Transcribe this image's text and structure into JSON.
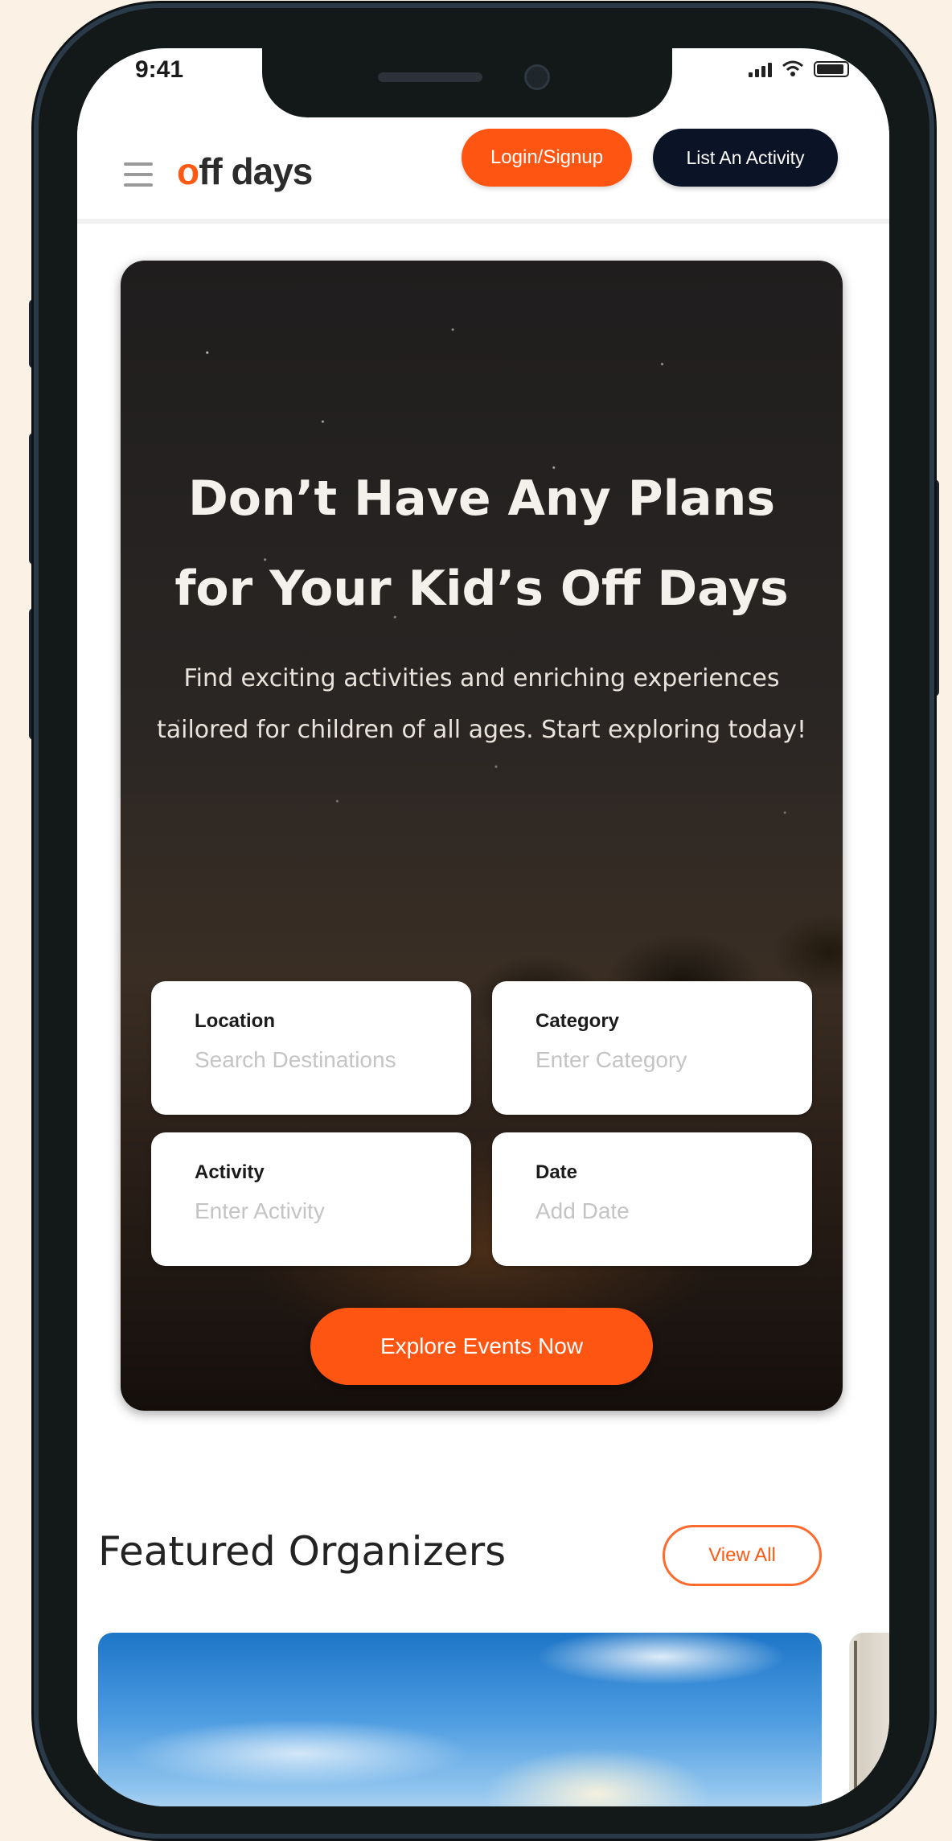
{
  "status_bar": {
    "time": "9:41"
  },
  "header": {
    "logo_first": "o",
    "logo_rest": "ff days",
    "login_label": "Login/Signup",
    "list_activity_label": "List An Activity"
  },
  "hero": {
    "title_line1": "Don’t Have Any Plans",
    "title_line2": "for Your Kid’s Off Days",
    "subtitle": "Find exciting activities and enriching experiences tailored for children of all ages. Start exploring today!",
    "fields": [
      {
        "label": "Location",
        "placeholder": "Search Destinations"
      },
      {
        "label": "Category",
        "placeholder": "Enter Category"
      },
      {
        "label": "Activity",
        "placeholder": "Enter Activity"
      },
      {
        "label": "Date",
        "placeholder": "Add Date"
      }
    ],
    "explore_label": "Explore Events Now"
  },
  "featured": {
    "title": "Featured Organizers",
    "view_all_label": "View All"
  },
  "colors": {
    "brand_orange": "#ff5512",
    "navy": "#0b1326",
    "background": "#fbf2e5"
  },
  "icons": {
    "menu": "hamburger-menu-icon",
    "signal": "signal-icon",
    "wifi": "wifi-icon",
    "battery": "battery-icon"
  }
}
